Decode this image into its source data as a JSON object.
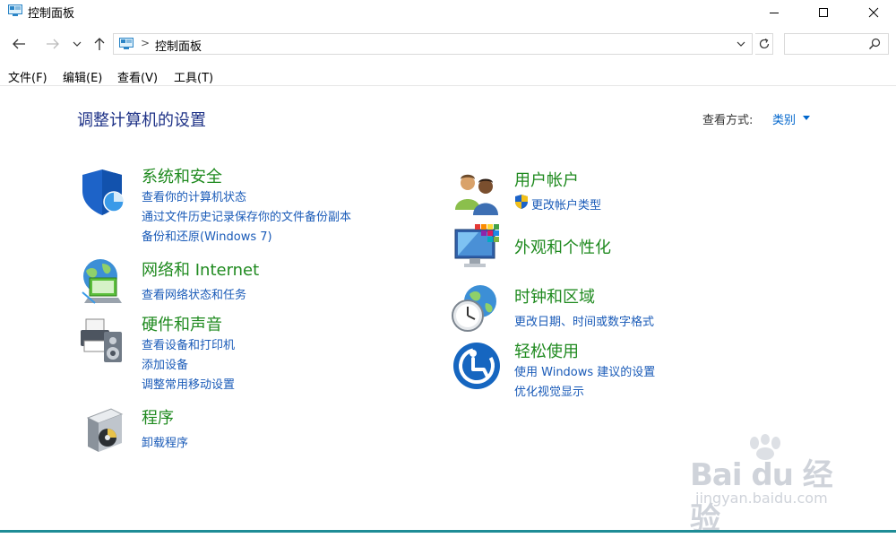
{
  "window": {
    "title": "控制面板",
    "icon": "control-panel-icon"
  },
  "nav": {
    "address": "控制面板",
    "separator": ">",
    "search_placeholder": ""
  },
  "menu": [
    "文件(F)",
    "编辑(E)",
    "查看(V)",
    "工具(T)"
  ],
  "page": {
    "title": "调整计算机的设置",
    "view_by_label": "查看方式:",
    "view_by_value": "类别"
  },
  "categories_left": [
    {
      "title": "系统和安全",
      "icon": "system-security-shield-icon",
      "links": [
        "查看你的计算机状态",
        "通过文件历史记录保存你的文件备份副本",
        "备份和还原(Windows 7)"
      ]
    },
    {
      "title": "网络和 Internet",
      "icon": "network-globe-icon",
      "links": [
        "查看网络状态和任务"
      ]
    },
    {
      "title": "硬件和声音",
      "icon": "printer-speaker-icon",
      "links": [
        "查看设备和打印机",
        "添加设备",
        "调整常用移动设置"
      ]
    },
    {
      "title": "程序",
      "icon": "programs-disc-icon",
      "links": [
        "卸载程序"
      ]
    }
  ],
  "categories_right": [
    {
      "title": "用户帐户",
      "icon": "user-accounts-icon",
      "links": [
        "更改帐户类型"
      ]
    },
    {
      "title": "外观和个性化",
      "icon": "monitor-palette-icon",
      "links": []
    },
    {
      "title": "时钟和区域",
      "icon": "clock-globe-icon",
      "links": [
        "更改日期、时间或数字格式"
      ]
    },
    {
      "title": "轻松使用",
      "icon": "ease-of-access-icon",
      "links": [
        "使用 Windows 建议的设置",
        "优化视觉显示"
      ]
    }
  ],
  "watermark": {
    "brand": "Bai du 经验",
    "url": "jingyan.baidu.com"
  },
  "colors": {
    "title_blue": "#1e3287",
    "category_green": "#1f8a1f",
    "link_blue": "#1a5bb8",
    "accent_teal": "#1e8c96"
  }
}
